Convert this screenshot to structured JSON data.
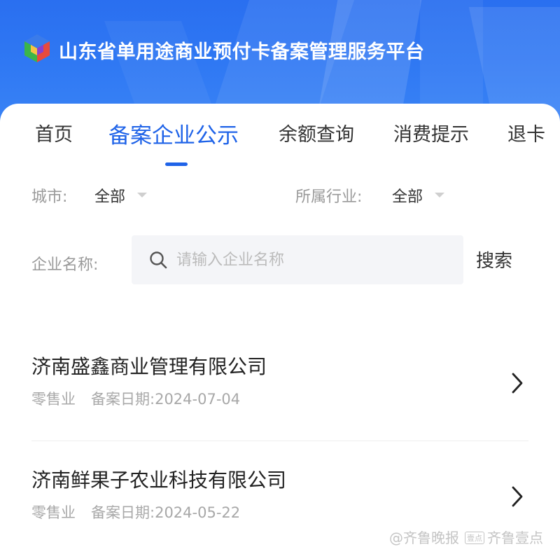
{
  "header": {
    "title": "山东省单用途商业预付卡备案管理服务平台",
    "logo_icon": "cube-logo-icon",
    "background_color": "#2f78f3"
  },
  "tabs": [
    {
      "label": "首页",
      "active": false
    },
    {
      "label": "备案企业公示",
      "active": true
    },
    {
      "label": "余额查询",
      "active": false
    },
    {
      "label": "消费提示",
      "active": false
    },
    {
      "label": "退卡",
      "active": false
    }
  ],
  "accent_color": "#1f63e8",
  "filters": {
    "city_label": "城市:",
    "city_value": "全部",
    "industry_label": "所属行业:",
    "industry_value": "全部"
  },
  "search": {
    "label": "企业名称:",
    "placeholder": "请输入企业名称",
    "button_label": "搜索",
    "icon": "search-icon"
  },
  "companies": [
    {
      "name": "济南盛鑫商业管理有限公司",
      "industry": "零售业",
      "date_label": "备案日期:",
      "date": "2024-07-04"
    },
    {
      "name": "济南鲜果子农业科技有限公司",
      "industry": "零售业",
      "date_label": "备案日期:",
      "date": "2024-05-22"
    }
  ],
  "watermark": {
    "left_text": "@齐鲁晚报",
    "box_text": "壹点",
    "right_text": "齐鲁壹点"
  }
}
